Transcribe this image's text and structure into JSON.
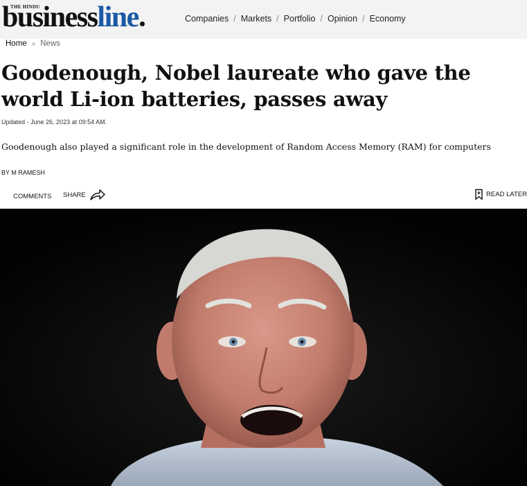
{
  "brand": {
    "small": "THE HINDU",
    "name_black": "business",
    "name_blue": "line"
  },
  "nav": {
    "items": [
      "Companies",
      "Markets",
      "Portfolio",
      "Opinion",
      "Economy"
    ],
    "separator": "/"
  },
  "breadcrumb": {
    "home": "Home",
    "separator": "»",
    "section": "News"
  },
  "article": {
    "title": "Goodenough, Nobel laureate who gave the world Li-ion batteries, passes away",
    "updated": "Updated - June 26, 2023 at 09:54 AM.",
    "summary": "Goodenough also played a significant role in the development of Random Access Memory (RAM) for computers",
    "byline": "BY M RAMESH"
  },
  "actions": {
    "comments": "COMMENTS",
    "share": "SHARE",
    "read_later": "READ LATER"
  },
  "colors": {
    "brand_blue": "#1a5aa5",
    "header_bg": "#f3f3f3",
    "photo_bg": "#040404"
  },
  "icons": [
    "share-arrow-icon",
    "bookmark-icon"
  ]
}
